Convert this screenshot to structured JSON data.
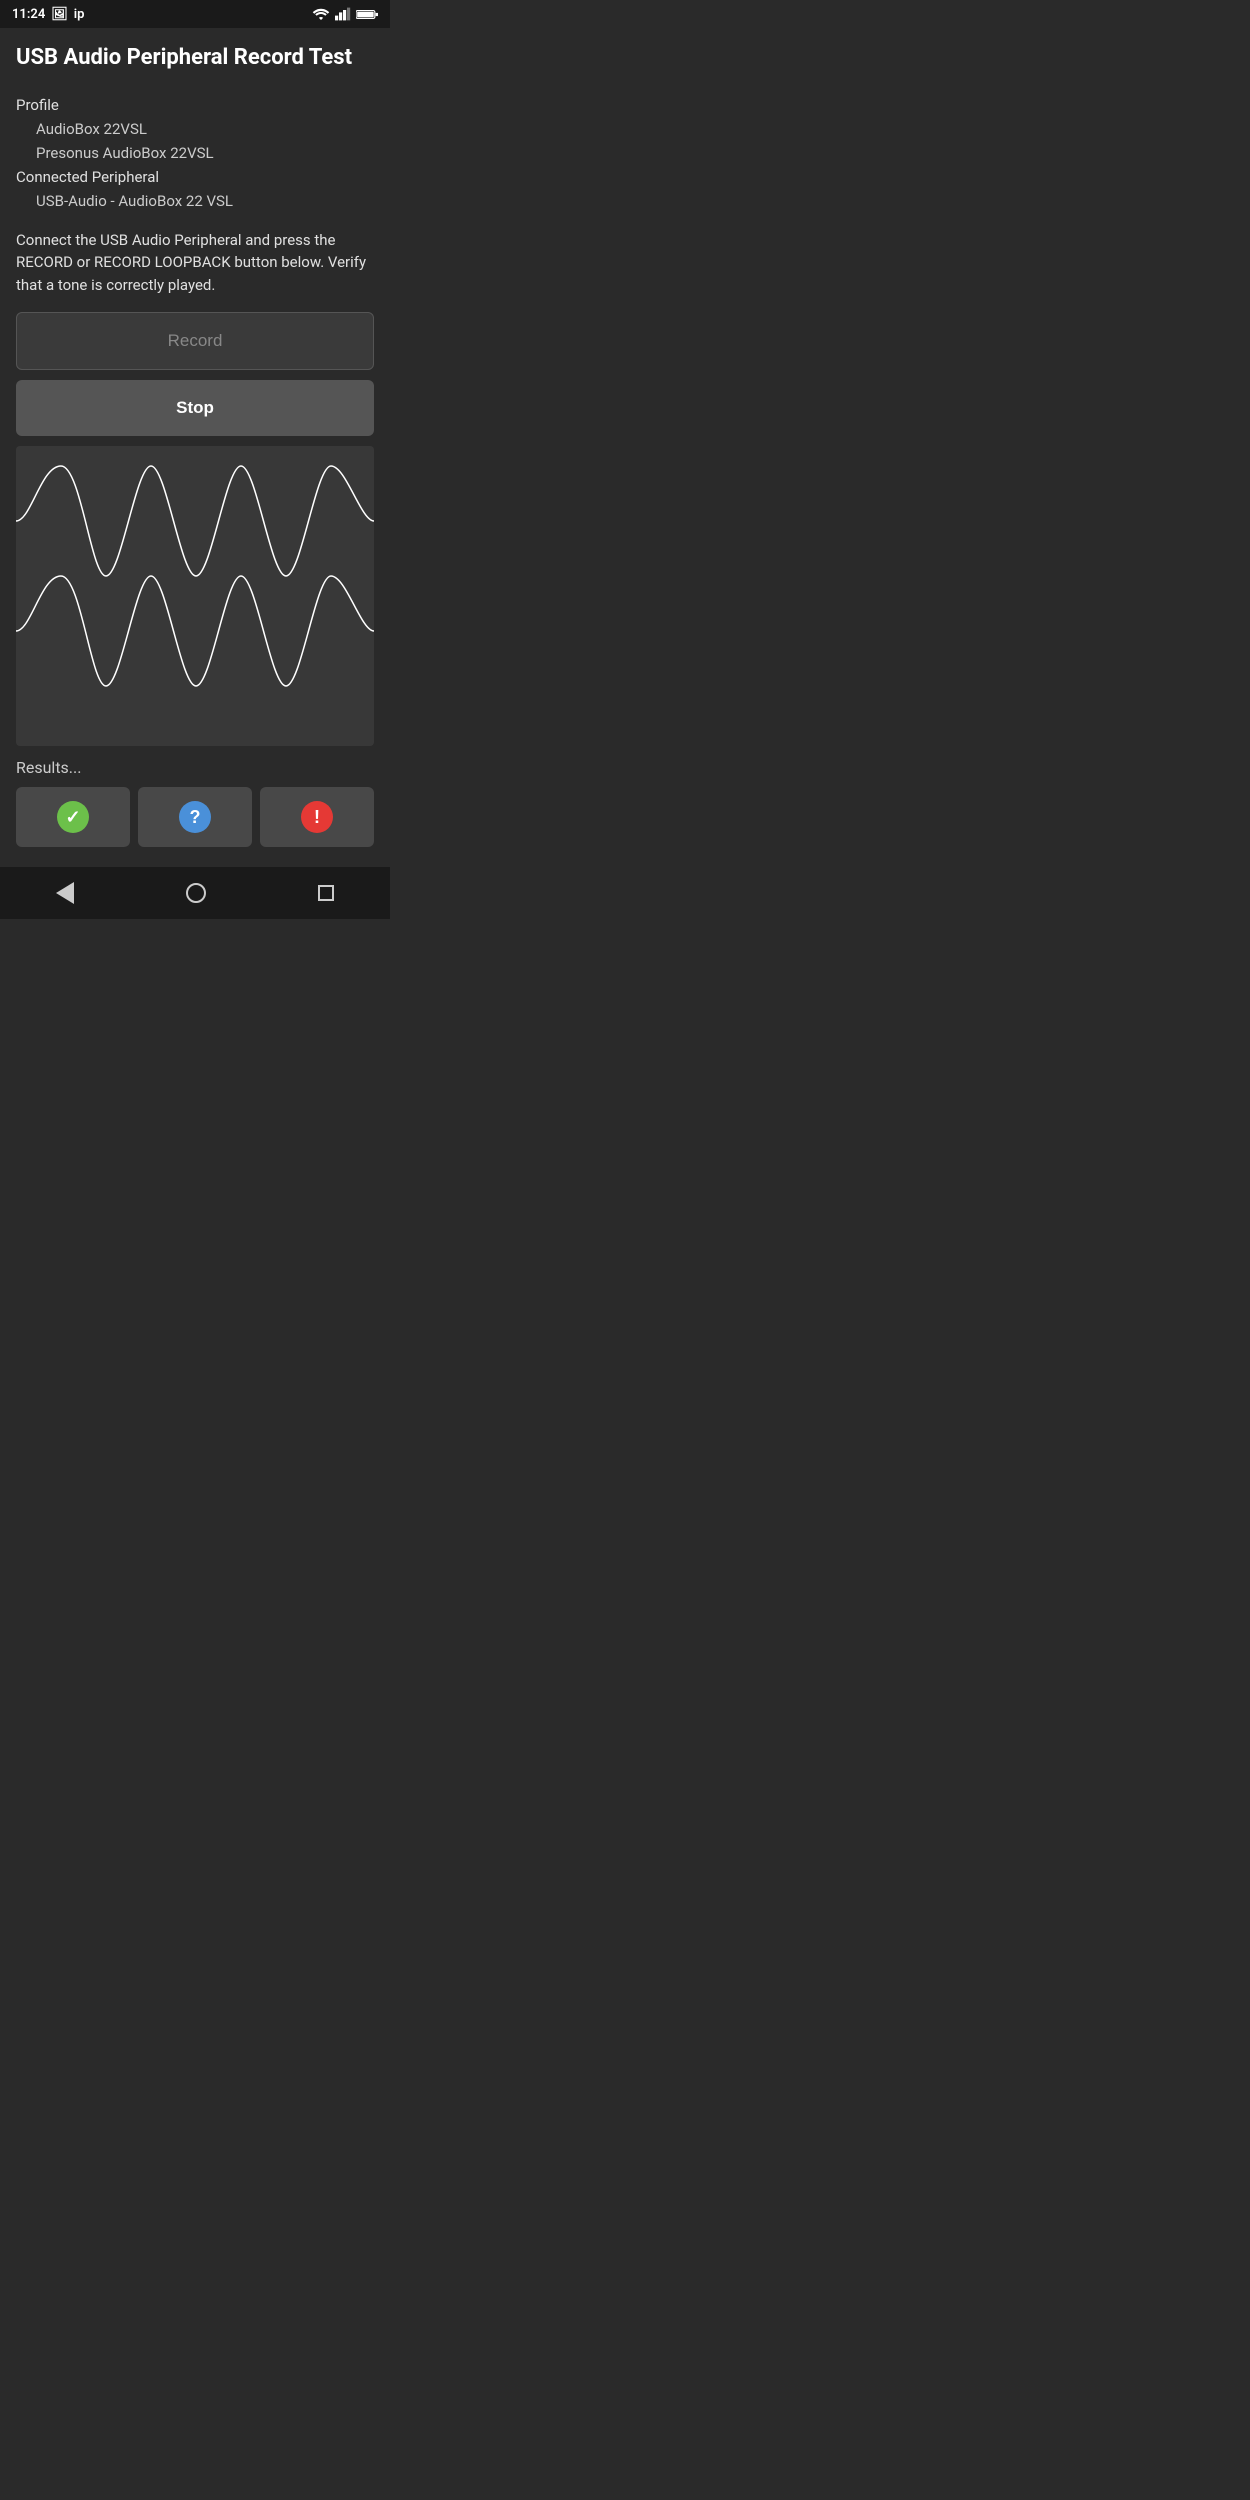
{
  "statusBar": {
    "time": "11:24",
    "leftIcons": [
      "photo-icon",
      "ip-icon"
    ],
    "rightIcons": [
      "wifi-icon",
      "signal-icon",
      "battery-icon"
    ]
  },
  "header": {
    "title": "USB Audio Peripheral Record Test"
  },
  "profile": {
    "label": "Profile",
    "line1": "AudioBox 22VSL",
    "line2": "Presonus AudioBox 22VSL"
  },
  "peripheral": {
    "label": "Connected Peripheral",
    "line1": "USB-Audio - AudioBox 22 VSL"
  },
  "instructions": {
    "text": "Connect the USB Audio Peripheral and press the RECORD or RECORD LOOPBACK button below. Verify that a tone is correctly played."
  },
  "buttons": {
    "record": "Record",
    "stop": "Stop"
  },
  "waveform": {
    "description": "sine wave visualization"
  },
  "results": {
    "label": "Results...",
    "buttons": [
      {
        "type": "check",
        "icon": "✓",
        "label": "pass"
      },
      {
        "type": "question",
        "icon": "?",
        "label": "unknown"
      },
      {
        "type": "exclaim",
        "icon": "!",
        "label": "fail"
      }
    ]
  },
  "navigation": {
    "back": "back",
    "home": "home",
    "recent": "recent"
  }
}
